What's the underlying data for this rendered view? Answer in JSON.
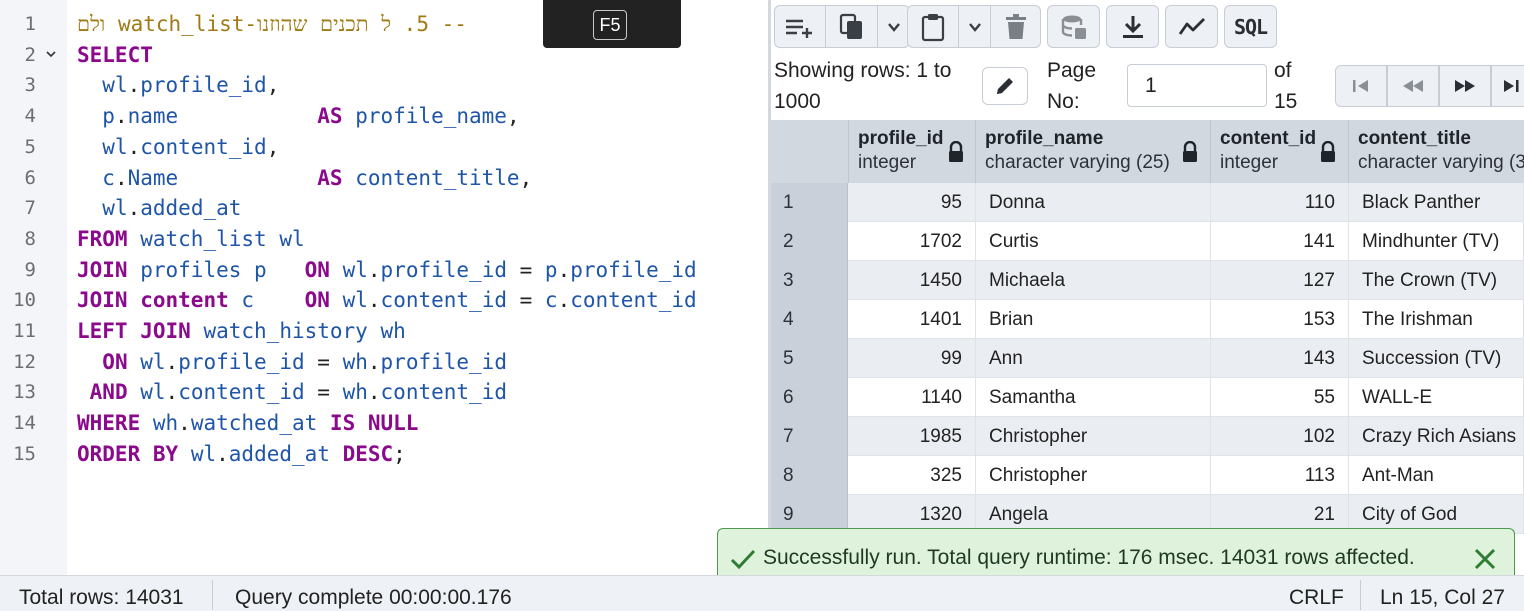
{
  "editor": {
    "line_numbers": [
      "1",
      "2",
      "3",
      "4",
      "5",
      "6",
      "7",
      "8",
      "9",
      "10",
      "11",
      "12",
      "13",
      "14",
      "15"
    ],
    "comment_line": "-- 5. ל תכנים שהוזנו-watch_list ולם",
    "shortcut_key": "F5",
    "lines": [
      [
        [
          "cm",
          "-- 5. ל תכנים שהוזנו-watch_list ולם"
        ]
      ],
      [
        [
          "kw",
          "SELECT"
        ]
      ],
      [
        [
          "pl",
          "  "
        ],
        [
          "id",
          "wl"
        ],
        [
          "pl",
          "."
        ],
        [
          "id",
          "profile_id"
        ],
        [
          "pl",
          ","
        ]
      ],
      [
        [
          "pl",
          "  "
        ],
        [
          "id",
          "p"
        ],
        [
          "pl",
          "."
        ],
        [
          "id",
          "name"
        ],
        [
          "pl",
          "           "
        ],
        [
          "kw",
          "AS"
        ],
        [
          "pl",
          " "
        ],
        [
          "id",
          "profile_name"
        ],
        [
          "pl",
          ","
        ]
      ],
      [
        [
          "pl",
          "  "
        ],
        [
          "id",
          "wl"
        ],
        [
          "pl",
          "."
        ],
        [
          "id",
          "content_id"
        ],
        [
          "pl",
          ","
        ]
      ],
      [
        [
          "pl",
          "  "
        ],
        [
          "id",
          "c"
        ],
        [
          "pl",
          "."
        ],
        [
          "id",
          "Name"
        ],
        [
          "pl",
          "           "
        ],
        [
          "kw",
          "AS"
        ],
        [
          "pl",
          " "
        ],
        [
          "id",
          "content_title"
        ],
        [
          "pl",
          ","
        ]
      ],
      [
        [
          "pl",
          "  "
        ],
        [
          "id",
          "wl"
        ],
        [
          "pl",
          "."
        ],
        [
          "id",
          "added_at"
        ]
      ],
      [
        [
          "kw",
          "FROM"
        ],
        [
          "pl",
          " "
        ],
        [
          "id",
          "watch_list"
        ],
        [
          "pl",
          " "
        ],
        [
          "id",
          "wl"
        ]
      ],
      [
        [
          "kw",
          "JOIN"
        ],
        [
          "pl",
          " "
        ],
        [
          "id",
          "profiles"
        ],
        [
          "pl",
          " "
        ],
        [
          "id",
          "p"
        ],
        [
          "pl",
          "   "
        ],
        [
          "kw",
          "ON"
        ],
        [
          "pl",
          " "
        ],
        [
          "id",
          "wl"
        ],
        [
          "pl",
          "."
        ],
        [
          "id",
          "profile_id"
        ],
        [
          "pl",
          " = "
        ],
        [
          "id",
          "p"
        ],
        [
          "pl",
          "."
        ],
        [
          "id",
          "profile_id"
        ]
      ],
      [
        [
          "kw",
          "JOIN"
        ],
        [
          "pl",
          " "
        ],
        [
          "kw",
          "content"
        ],
        [
          "pl",
          " "
        ],
        [
          "id",
          "c"
        ],
        [
          "pl",
          "    "
        ],
        [
          "kw",
          "ON"
        ],
        [
          "pl",
          " "
        ],
        [
          "id",
          "wl"
        ],
        [
          "pl",
          "."
        ],
        [
          "id",
          "content_id"
        ],
        [
          "pl",
          " = "
        ],
        [
          "id",
          "c"
        ],
        [
          "pl",
          "."
        ],
        [
          "id",
          "content_id"
        ]
      ],
      [
        [
          "kw",
          "LEFT"
        ],
        [
          "pl",
          " "
        ],
        [
          "kw",
          "JOIN"
        ],
        [
          "pl",
          " "
        ],
        [
          "id",
          "watch_history"
        ],
        [
          "pl",
          " "
        ],
        [
          "id",
          "wh"
        ]
      ],
      [
        [
          "pl",
          "  "
        ],
        [
          "kw",
          "ON"
        ],
        [
          "pl",
          " "
        ],
        [
          "id",
          "wl"
        ],
        [
          "pl",
          "."
        ],
        [
          "id",
          "profile_id"
        ],
        [
          "pl",
          " = "
        ],
        [
          "id",
          "wh"
        ],
        [
          "pl",
          "."
        ],
        [
          "id",
          "profile_id"
        ]
      ],
      [
        [
          "pl",
          " "
        ],
        [
          "kw",
          "AND"
        ],
        [
          "pl",
          " "
        ],
        [
          "id",
          "wl"
        ],
        [
          "pl",
          "."
        ],
        [
          "id",
          "content_id"
        ],
        [
          "pl",
          " = "
        ],
        [
          "id",
          "wh"
        ],
        [
          "pl",
          "."
        ],
        [
          "id",
          "content_id"
        ]
      ],
      [
        [
          "kw",
          "WHERE"
        ],
        [
          "pl",
          " "
        ],
        [
          "id",
          "wh"
        ],
        [
          "pl",
          "."
        ],
        [
          "id",
          "watched_at"
        ],
        [
          "pl",
          " "
        ],
        [
          "kw",
          "IS"
        ],
        [
          "pl",
          " "
        ],
        [
          "kw",
          "NULL"
        ]
      ],
      [
        [
          "kw",
          "ORDER"
        ],
        [
          "pl",
          " "
        ],
        [
          "kw",
          "BY"
        ],
        [
          "pl",
          " "
        ],
        [
          "id",
          "wl"
        ],
        [
          "pl",
          "."
        ],
        [
          "id",
          "added_at"
        ],
        [
          "pl",
          " "
        ],
        [
          "kw",
          "DESC"
        ],
        [
          "pl",
          ";"
        ]
      ]
    ]
  },
  "toolbar": {
    "buttons": [
      "add-row-icon",
      "copy-icon",
      "chevron-down-icon",
      "paste-icon",
      "chevron-down-icon",
      "delete-icon",
      "save-data-icon",
      "download-icon",
      "graph-icon"
    ],
    "sql_label": "SQL"
  },
  "pager": {
    "showing_line1": "Showing rows: 1 to",
    "showing_line2": "1000",
    "page_label_1": "Page",
    "page_label_2": "No:",
    "page_value": "1",
    "of_label": "of",
    "of_value": "15"
  },
  "grid": {
    "columns": [
      {
        "name": "profile_id",
        "type": "integer"
      },
      {
        "name": "profile_name",
        "type": "character varying (25)"
      },
      {
        "name": "content_id",
        "type": "integer"
      },
      {
        "name": "content_title",
        "type": "character varying (3"
      }
    ],
    "rows": [
      {
        "n": "1",
        "profile_id": "95",
        "profile_name": "Donna",
        "content_id": "110",
        "content_title": "Black Panther"
      },
      {
        "n": "2",
        "profile_id": "1702",
        "profile_name": "Curtis",
        "content_id": "141",
        "content_title": "Mindhunter (TV)"
      },
      {
        "n": "3",
        "profile_id": "1450",
        "profile_name": "Michaela",
        "content_id": "127",
        "content_title": "The Crown (TV)"
      },
      {
        "n": "4",
        "profile_id": "1401",
        "profile_name": "Brian",
        "content_id": "153",
        "content_title": "The Irishman"
      },
      {
        "n": "5",
        "profile_id": "99",
        "profile_name": "Ann",
        "content_id": "143",
        "content_title": "Succession (TV)"
      },
      {
        "n": "6",
        "profile_id": "1140",
        "profile_name": "Samantha",
        "content_id": "55",
        "content_title": "WALL-E"
      },
      {
        "n": "7",
        "profile_id": "1985",
        "profile_name": "Christopher",
        "content_id": "102",
        "content_title": "Crazy Rich Asians"
      },
      {
        "n": "8",
        "profile_id": "325",
        "profile_name": "Christopher",
        "content_id": "113",
        "content_title": "Ant-Man"
      },
      {
        "n": "9",
        "profile_id": "1320",
        "profile_name": "Angela",
        "content_id": "21",
        "content_title": "City of God"
      }
    ]
  },
  "toast": {
    "message": "Successfully run. Total query runtime: 176 msec. 14031 rows affected.",
    "color": "#4b9b4a"
  },
  "status": {
    "total_rows": "Total rows: 14031",
    "query_complete": "Query complete 00:00:00.176",
    "line_ending": "CRLF",
    "cursor": "Ln 15, Col 27"
  }
}
